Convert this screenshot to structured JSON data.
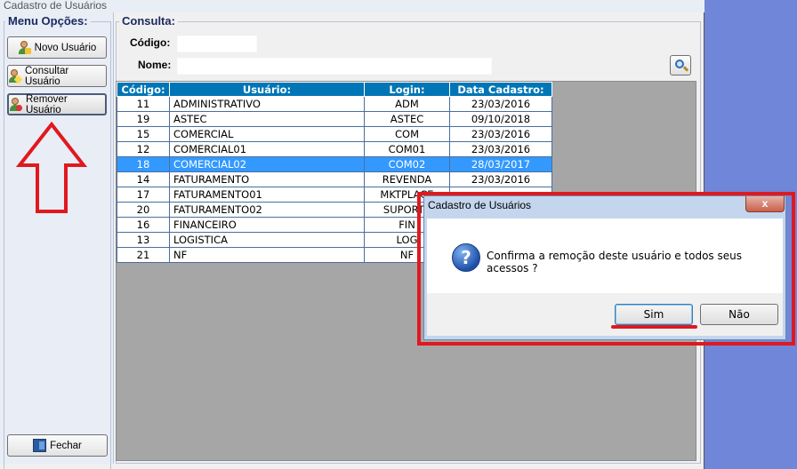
{
  "window": {
    "title": "Cadastro de Usuários"
  },
  "menu": {
    "title": "Menu Opções:",
    "novo_label": "Novo Usuário",
    "consultar_label": "Consultar Usuário",
    "remover_label": "Remover Usuário",
    "fechar_label": "Fechar"
  },
  "consulta": {
    "title": "Consulta:",
    "codigo_label": "Código:",
    "codigo_value": "",
    "nome_label": "Nome:",
    "nome_value": ""
  },
  "grid": {
    "headers": [
      "Código:",
      "Usuário:",
      "Login:",
      "Data Cadastro:"
    ],
    "rows": [
      {
        "codigo": "11",
        "usuario": "ADMINISTRATIVO",
        "login": "ADM",
        "data": "23/03/2016"
      },
      {
        "codigo": "19",
        "usuario": "ASTEC",
        "login": "ASTEC",
        "data": "09/10/2018"
      },
      {
        "codigo": "15",
        "usuario": "COMERCIAL",
        "login": "COM",
        "data": "23/03/2016"
      },
      {
        "codigo": "12",
        "usuario": "COMERCIAL01",
        "login": "COM01",
        "data": "23/03/2016"
      },
      {
        "codigo": "18",
        "usuario": "COMERCIAL02",
        "login": "COM02",
        "data": "28/03/2017",
        "selected": true
      },
      {
        "codigo": "14",
        "usuario": "FATURAMENTO",
        "login": "REVENDA",
        "data": "23/03/2016"
      },
      {
        "codigo": "17",
        "usuario": "FATURAMENTO01",
        "login": "MKTPLACE",
        "data": ""
      },
      {
        "codigo": "20",
        "usuario": "FATURAMENTO02",
        "login": "SUPORTE",
        "data": ""
      },
      {
        "codigo": "16",
        "usuario": "FINANCEIRO",
        "login": "FIN",
        "data": ""
      },
      {
        "codigo": "13",
        "usuario": "LOGISTICA",
        "login": "LOG",
        "data": ""
      },
      {
        "codigo": "21",
        "usuario": "NF",
        "login": "NF",
        "data": ""
      }
    ]
  },
  "dialog": {
    "title": "Cadastro de Usuários",
    "close_label": "x",
    "icon_glyph": "?",
    "message": "Confirma a remoção deste usuário e todos seus acessos ?",
    "yes_label": "Sim",
    "no_label": "Não"
  },
  "colors": {
    "header_bg": "#0076b6",
    "selected_row": "#3399ff",
    "highlight_red": "#e0191e",
    "desktop_bg": "#6f86d9"
  }
}
